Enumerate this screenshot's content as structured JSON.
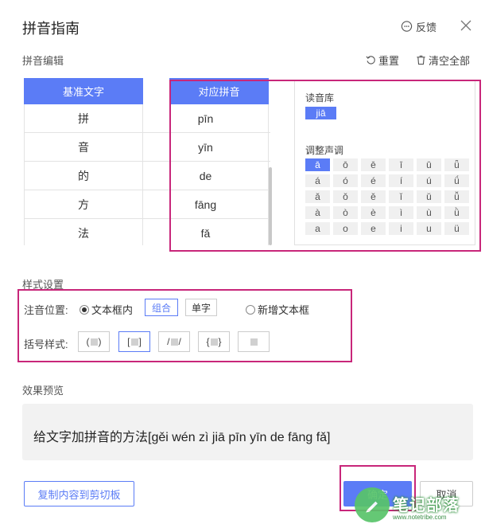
{
  "window": {
    "title": "拼音指南",
    "feedback_label": "反馈"
  },
  "editor": {
    "section_label": "拼音编辑",
    "reset_label": "重置",
    "clear_all_label": "清空全部",
    "table": {
      "headers": [
        "基准文字",
        "对应拼音"
      ],
      "rows": [
        {
          "char": "拼",
          "pinyin": "pīn"
        },
        {
          "char": "音",
          "pinyin": "yīn"
        },
        {
          "char": "的",
          "pinyin": "de"
        },
        {
          "char": "方",
          "pinyin": "fāng"
        },
        {
          "char": "法",
          "pinyin": "fǎ"
        }
      ]
    }
  },
  "library": {
    "title": "读音库",
    "current": "jiā",
    "tone_title": "调整声调",
    "tones": [
      "ā",
      "ō",
      "ē",
      "ī",
      "ū",
      "ǖ",
      "á",
      "ó",
      "é",
      "í",
      "ú",
      "ǘ",
      "ǎ",
      "ǒ",
      "ě",
      "ǐ",
      "ǔ",
      "ǚ",
      "à",
      "ò",
      "è",
      "ì",
      "ù",
      "ǜ",
      "a",
      "o",
      "e",
      "i",
      "u",
      "ü"
    ],
    "selected_tone": "ā"
  },
  "style": {
    "section_label": "样式设置",
    "position_label": "注音位置:",
    "option_in_box": "文本框内",
    "combine_label": "组合",
    "single_label": "单字",
    "option_new_box": "新增文本框",
    "bracket_label": "括号样式:",
    "bracket_styles": [
      {
        "open": "(",
        "close": ")"
      },
      {
        "open": "[",
        "close": "]"
      },
      {
        "open": "/",
        "close": "/"
      },
      {
        "open": "{",
        "close": "}"
      },
      {
        "open": "",
        "close": ""
      }
    ]
  },
  "preview": {
    "section_label": "效果预览",
    "text": "给文字加拼音的方法[gěi wén zì jiā pīn yīn de fāng fǎ]"
  },
  "footer": {
    "copy_label": "复制内容到剪切板",
    "ok_label": "确定",
    "cancel_label": "取消"
  },
  "watermark": {
    "text": "笔记部落",
    "url": "www.notetribe.com"
  },
  "colors": {
    "accent": "#5b7cf6",
    "highlight": "#c8267a",
    "watermark_green": "#58c46a"
  }
}
